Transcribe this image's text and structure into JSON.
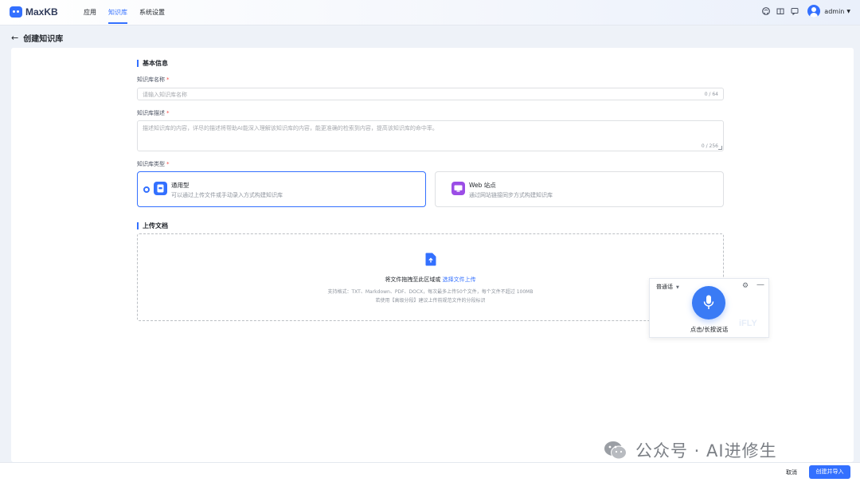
{
  "app": {
    "name": "MaxKB"
  },
  "nav": {
    "items": [
      "应用",
      "知识库",
      "系统设置"
    ],
    "active": "知识库"
  },
  "user": {
    "name": "admin"
  },
  "header": {
    "title": "创建知识库"
  },
  "basic_info": {
    "section_title": "基本信息",
    "name_label": "知识库名称",
    "name_placeholder": "请输入知识库名称",
    "name_counter": "0 / 64",
    "desc_label": "知识库描述",
    "desc_placeholder": "描述知识库的内容，详尽的描述将帮助AI能深入理解该知识库的内容，能更准确的检索到内容，提高该知识库的命中率。",
    "desc_counter": "0 / 256",
    "type_label": "知识库类型",
    "required_mark": "*",
    "types": [
      {
        "name": "通用型",
        "desc": "可以通过上传文件或手动录入方式构建知识库",
        "selected": true,
        "icon": "document-icon"
      },
      {
        "name": "Web 站点",
        "desc": "通过网站链接同步方式构建知识库",
        "selected": false,
        "icon": "web-site-icon"
      }
    ]
  },
  "upload": {
    "section_title": "上传文档",
    "main_text": "将文件拖拽至此区域或",
    "link_text": "选择文件上传",
    "tip_formats": "支持格式：TXT、Markdown、PDF、DOCX，每次最多上传50个文件，每个文件不超过 100MB",
    "tip_advanced": "若使用【高级分段】建议上传前规范文件的分段标识"
  },
  "voice_widget": {
    "language": "普通话",
    "label": "点击/长按说话",
    "watermark": "iFLY"
  },
  "footer": {
    "cancel": "取消",
    "submit": "创建并导入"
  },
  "watermark": {
    "text": "公众号 · AI进修生"
  },
  "colors": {
    "primary": "#3370ff",
    "purple": "#9b4de6",
    "mic": "#3a7bf5"
  }
}
